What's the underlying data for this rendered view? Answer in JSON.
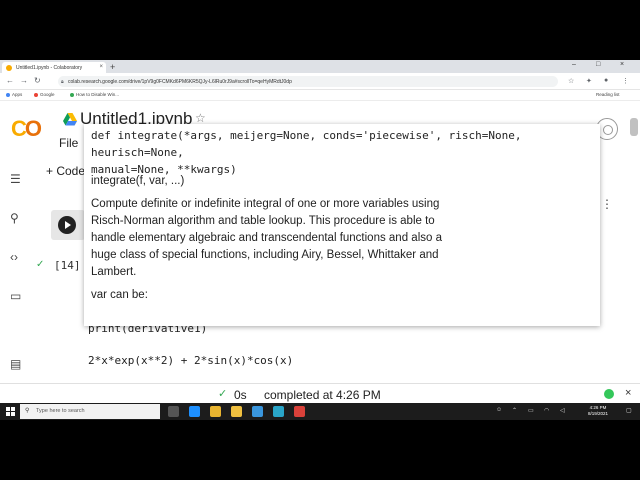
{
  "browser": {
    "tab_title": "Untitled1.ipynb - Colaboratory",
    "tab_close": "×",
    "new_tab": "+",
    "window_controls": [
      "–",
      "□",
      "×"
    ],
    "url": "colab.research.google.com/drive/1pV9g0FCMKd6PM6KR5QJy-L6lRu0rJ9a#scrollTo=qeHyMRdtJ0dp",
    "bookmarks": [
      "Apps",
      "Google",
      "How to Disable Win..."
    ],
    "reading_list": "Reading list"
  },
  "colab": {
    "logo": {
      "c": "C",
      "o": "O"
    },
    "notebook_title": "Untitled1.ipynb",
    "menu_file": "File",
    "add_code": "+ Code",
    "cell": {
      "exec_count": "[14]",
      "code_line": "print(derivative1)",
      "output": "2*x*exp(x**2) + 2*sin(x)*cos(x)"
    },
    "tooltip": {
      "signature": "def integrate(*args, meijerg=None, conds='piecewise', risch=None, heurisch=None,\nmanual=None, **kwargs)",
      "title": "integrate(f, var, ...)",
      "body": "Compute definite or indefinite integral of one or more variables using Risch-Norman algorithm and table lookup. This procedure is able to handle elementary algebraic and transcendental functions and also a huge class of special functions, including Airy, Bessel, Whittaker and Lambert.",
      "var_line": "var can be:"
    },
    "status": {
      "check": "✓",
      "duration": "0s",
      "completed": "completed at 4:26 PM"
    }
  },
  "taskbar": {
    "search_placeholder": "Type here to search",
    "time": "4:26 PM",
    "date": "8/19/2021"
  }
}
